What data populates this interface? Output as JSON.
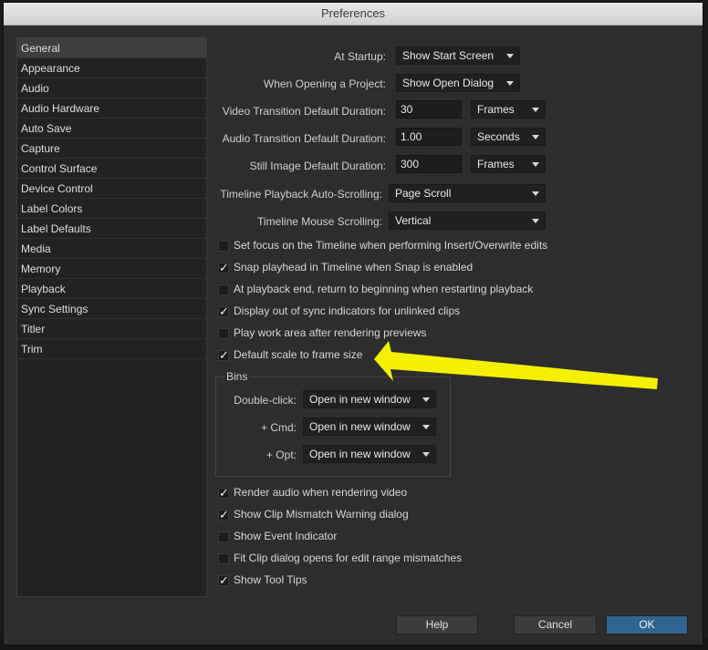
{
  "window": {
    "title": "Preferences"
  },
  "sidebar": {
    "items": [
      {
        "label": "General",
        "selected": true
      },
      {
        "label": "Appearance"
      },
      {
        "label": "Audio"
      },
      {
        "label": "Audio Hardware"
      },
      {
        "label": "Auto Save"
      },
      {
        "label": "Capture"
      },
      {
        "label": "Control Surface"
      },
      {
        "label": "Device Control"
      },
      {
        "label": "Label Colors"
      },
      {
        "label": "Label Defaults"
      },
      {
        "label": "Media"
      },
      {
        "label": "Memory"
      },
      {
        "label": "Playback"
      },
      {
        "label": "Sync Settings"
      },
      {
        "label": "Titler"
      },
      {
        "label": "Trim"
      }
    ]
  },
  "general": {
    "at_startup": {
      "label": "At Startup:",
      "value": "Show Start Screen"
    },
    "when_opening": {
      "label": "When Opening a Project:",
      "value": "Show Open Dialog"
    },
    "video_transition": {
      "label": "Video Transition Default Duration:",
      "value": "30",
      "unit": "Frames"
    },
    "audio_transition": {
      "label": "Audio Transition Default Duration:",
      "value": "1.00",
      "unit": "Seconds"
    },
    "still_image": {
      "label": "Still Image Default Duration:",
      "value": "300",
      "unit": "Frames"
    },
    "playback_autoscroll": {
      "label": "Timeline Playback Auto-Scrolling:",
      "value": "Page Scroll"
    },
    "mouse_scrolling": {
      "label": "Timeline Mouse Scrolling:",
      "value": "Vertical"
    },
    "checkboxes": [
      {
        "label": "Set focus on the Timeline when performing Insert/Overwrite edits",
        "checked": false
      },
      {
        "label": "Snap playhead in Timeline when Snap is enabled",
        "checked": true
      },
      {
        "label": "At playback end, return to beginning when restarting playback",
        "checked": false
      },
      {
        "label": "Display out of sync indicators for unlinked clips",
        "checked": true
      },
      {
        "label": "Play work area after rendering previews",
        "checked": false
      },
      {
        "label": "Default scale to frame size",
        "checked": true
      }
    ],
    "bins": {
      "title": "Bins",
      "double_click": {
        "label": "Double-click:",
        "value": "Open in new window"
      },
      "cmd": {
        "label": "+ Cmd:",
        "value": "Open in new window"
      },
      "opt": {
        "label": "+ Opt:",
        "value": "Open in new window"
      }
    },
    "checkboxes2": [
      {
        "label": "Render audio when rendering video",
        "checked": true
      },
      {
        "label": "Show Clip Mismatch Warning dialog",
        "checked": true
      },
      {
        "label": "Show Event Indicator",
        "checked": false
      },
      {
        "label": "Fit Clip dialog opens for edit range mismatches",
        "checked": false
      },
      {
        "label": "Show Tool Tips",
        "checked": true
      }
    ],
    "check_glyph": "✓"
  },
  "buttons": {
    "help": "Help",
    "cancel": "Cancel",
    "ok": "OK"
  },
  "colors": {
    "accent": "#2f6590",
    "annotation_arrow": "#f4f000"
  }
}
